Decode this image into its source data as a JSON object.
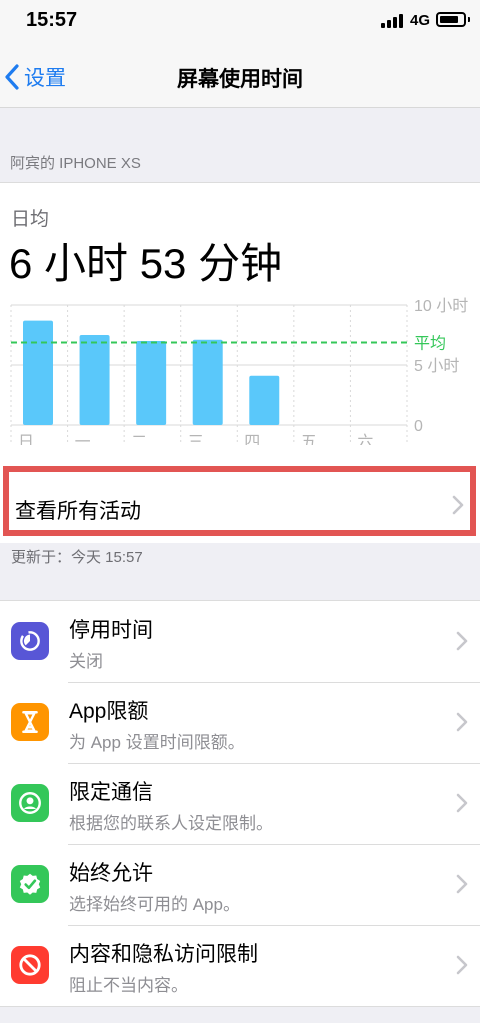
{
  "status_bar": {
    "time": "15:57",
    "network": "4G"
  },
  "nav": {
    "back_label": "设置",
    "title": "屏幕使用时间"
  },
  "device_header": "阿宾的 IPHONE XS",
  "summary": {
    "avg_label": "日均",
    "avg_value": "6 小时 53 分钟"
  },
  "chart_data": {
    "type": "bar",
    "categories": [
      "日",
      "一",
      "二",
      "三",
      "四",
      "五",
      "六"
    ],
    "values": [
      8.7,
      7.5,
      7.0,
      7.1,
      4.1,
      0,
      0
    ],
    "average": 6.88,
    "average_label": "平均",
    "ylim": [
      0,
      10
    ],
    "y_ticks": [
      {
        "value": 10,
        "label": "10 小时"
      },
      {
        "value": 5,
        "label": "5 小时"
      },
      {
        "value": 0,
        "label": "0"
      }
    ],
    "colors": {
      "bar": "#5ac8fa",
      "average": "#34c759",
      "grid": "#d9d9d9",
      "label": "#b5b5b5"
    }
  },
  "see_all": {
    "label": "查看所有活动"
  },
  "updated": "更新于：今天 15:57",
  "items": [
    {
      "title": "停用时间",
      "subtitle": "关闭",
      "icon": "downtime-icon",
      "color": "#5856d6"
    },
    {
      "title": "App限额",
      "subtitle": "为 App 设置时间限额。",
      "icon": "hourglass-icon",
      "color": "#ff9500"
    },
    {
      "title": "限定通信",
      "subtitle": "根据您的联系人设定限制。",
      "icon": "contact-icon",
      "color": "#34c759"
    },
    {
      "title": "始终允许",
      "subtitle": "选择始终可用的 App。",
      "icon": "checkmark-badge-icon",
      "color": "#34c759"
    },
    {
      "title": "内容和隐私访问限制",
      "subtitle": "阻止不当内容。",
      "icon": "restriction-icon",
      "color": "#ff3b30"
    }
  ]
}
